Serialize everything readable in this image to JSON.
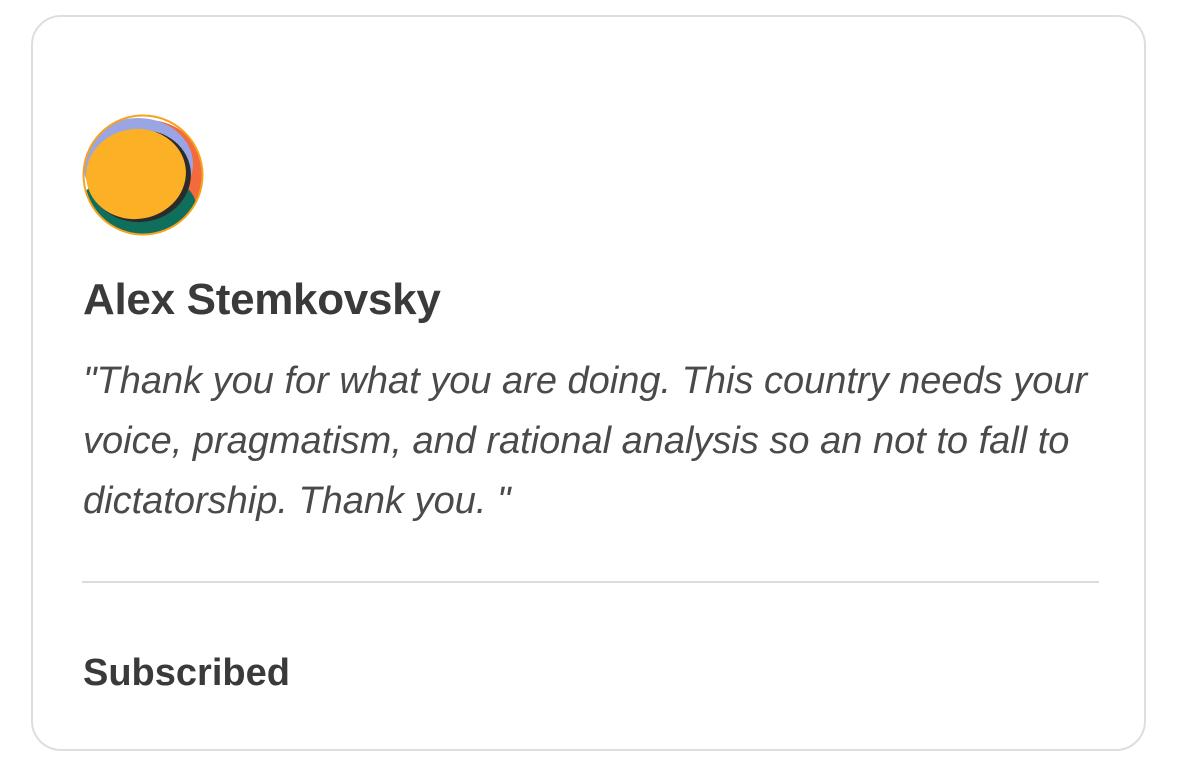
{
  "testimonial": {
    "author_name": "Alex Stemkovsky",
    "quote": "\"Thank you for what you are doing. This country needs your voice, pragmatism, and rational analysis so an not to fall to dictatorship. Thank you. \"",
    "status": "Subscribed"
  },
  "colors": {
    "avatar_primary": "#fbb025",
    "avatar_accent_purple": "#9aa5e6",
    "avatar_accent_green": "#0f6e5c",
    "avatar_accent_orange": "#f26a3d",
    "text_dark": "#3a3a3a",
    "border": "#dedede"
  }
}
